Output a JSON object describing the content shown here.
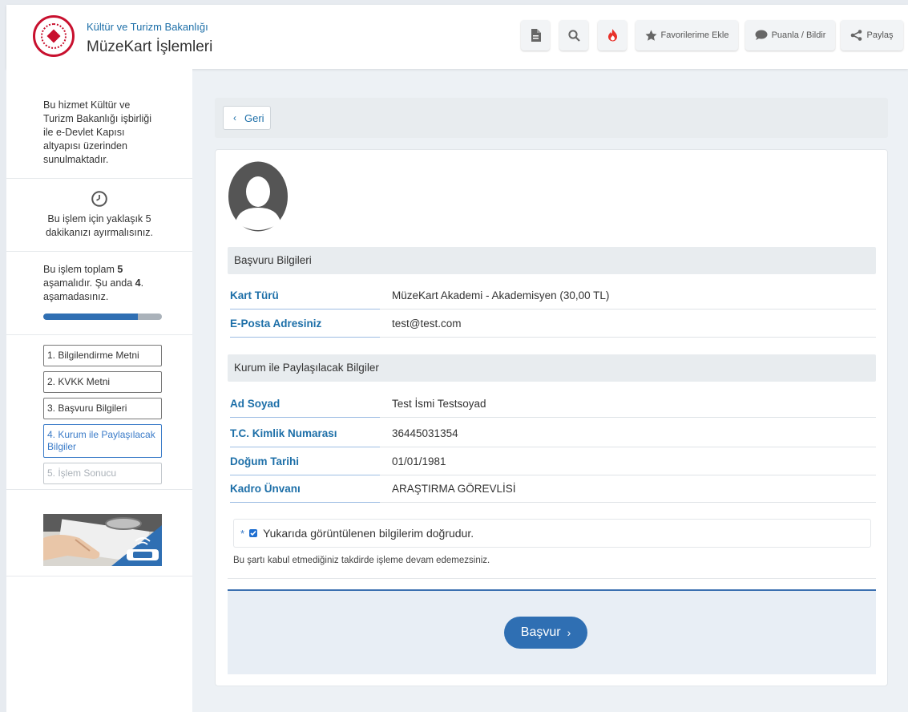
{
  "header": {
    "ministry": "Kültür ve Turizm Bakanlığı",
    "title": "MüzeKart İşlemleri",
    "buttons": {
      "favorites": "Favorilerime Ekle",
      "rate": "Puanla / Bildir",
      "share": "Paylaş"
    },
    "icons": [
      "document-icon",
      "search-icon",
      "fire-icon",
      "star-icon",
      "comment-icon",
      "share-icon"
    ],
    "accent_color": "#1d6fa8",
    "fire_color": "#e8322b"
  },
  "sidebar": {
    "intro": "Bu hizmet Kültür ve Turizm Bakanlığı işbirliği ile e-Devlet Kapısı altyapısı üzerinden sunulmaktadır.",
    "duration": "Bu işlem için yaklaşık 5 dakikanızı ayırmalısınız.",
    "progress_text_1": "Bu işlem toplam ",
    "progress_total": "5",
    "progress_text_2": " aşamalıdır. Şu anda ",
    "progress_current": "4",
    "progress_text_3": ". aşamadasınız.",
    "progress_fraction": 0.8,
    "steps": [
      {
        "label": "1. Bilgilendirme Metni",
        "state": "done"
      },
      {
        "label": "2. KVKK Metni",
        "state": "done"
      },
      {
        "label": "3. Başvuru Bilgileri",
        "state": "done"
      },
      {
        "label": "4. Kurum ile Paylaşılacak Bilgiler",
        "state": "active"
      },
      {
        "label": "5. İşlem Sonucu",
        "state": "disabled"
      }
    ]
  },
  "main": {
    "back_label": "Geri",
    "section1": {
      "title": "Başvuru Bilgileri",
      "rows": [
        {
          "label": "Kart Türü",
          "value": "MüzeKart Akademi - Akademisyen (30,00 TL)"
        },
        {
          "label": "E-Posta Adresiniz",
          "value": "test@test.com"
        }
      ]
    },
    "section2": {
      "title": "Kurum ile Paylaşılacak Bilgiler",
      "rows": [
        {
          "label": "Ad Soyad",
          "value": "Test İsmi Testsoyad"
        },
        {
          "label": "T.C. Kimlik Numarası",
          "value": "36445031354"
        },
        {
          "label": "Doğum Tarihi",
          "value": "01/01/1981"
        },
        {
          "label": "Kadro Ünvanı",
          "value": "ARAŞTIRMA GÖREVLİSİ"
        }
      ]
    },
    "confirm": {
      "required_mark": "*",
      "label": "Yukarıda görüntülenen bilgilerim doğrudur.",
      "checked": true
    },
    "note": "Bu şartı kabul etmediğiniz takdirde işleme devam edemezsiniz.",
    "submit_label": "Başvur"
  }
}
